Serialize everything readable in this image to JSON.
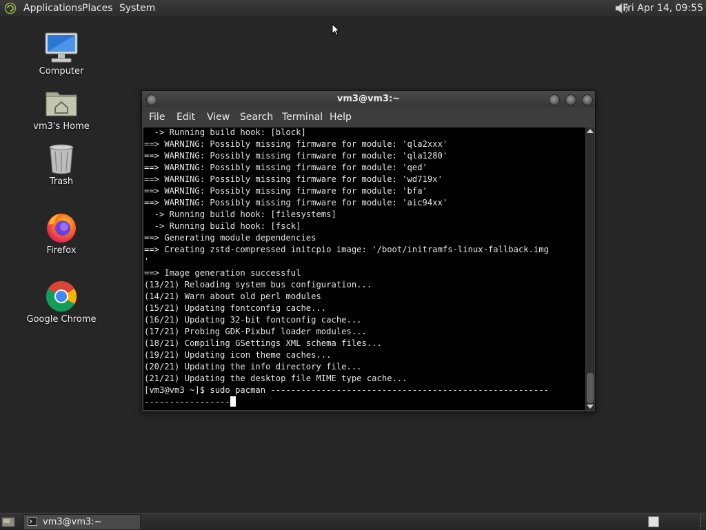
{
  "top_panel": {
    "menus": [
      "Applications",
      "Places",
      "System"
    ],
    "clock": "Fri Apr 14, 09:55"
  },
  "desktop_icons": [
    {
      "label": "Computer",
      "icon": "computer-icon"
    },
    {
      "label": "vm3's Home",
      "icon": "home-folder-icon"
    },
    {
      "label": "Trash",
      "icon": "trash-icon"
    },
    {
      "label": "Firefox",
      "icon": "firefox-icon"
    },
    {
      "label": "Google Chrome",
      "icon": "chrome-icon"
    }
  ],
  "terminal": {
    "title": "vm3@vm3:~",
    "menu": [
      "File",
      "Edit",
      "View",
      "Search",
      "Terminal",
      "Help"
    ],
    "lines": [
      "  -> Running build hook: [block]",
      "==> WARNING: Possibly missing firmware for module: 'qla2xxx'",
      "==> WARNING: Possibly missing firmware for module: 'qla1280'",
      "==> WARNING: Possibly missing firmware for module: 'qed'",
      "==> WARNING: Possibly missing firmware for module: 'wd719x'",
      "==> WARNING: Possibly missing firmware for module: 'bfa'",
      "==> WARNING: Possibly missing firmware for module: 'aic94xx'",
      "  -> Running build hook: [filesystems]",
      "  -> Running build hook: [fsck]",
      "==> Generating module dependencies",
      "==> Creating zstd-compressed initcpio image: '/boot/initramfs-linux-fallback.img",
      "'",
      "==> Image generation successful",
      "(13/21) Reloading system bus configuration...",
      "(14/21) Warn about old perl modules",
      "(15/21) Updating fontconfig cache...",
      "(16/21) Updating 32-bit fontconfig cache...",
      "(17/21) Probing GDK-Pixbuf loader modules...",
      "(18/21) Compiling GSettings XML schema files...",
      "(19/21) Updating icon theme caches...",
      "(20/21) Updating the info directory file...",
      "(21/21) Updating the desktop file MIME type cache...",
      "[vm3@vm3 ~]$ sudo pacman -------------------------------------------------------",
      "-----------------"
    ]
  },
  "taskbar": {
    "task_label": "vm3@vm3:~"
  },
  "colors": {
    "desktop_bg": "#262626",
    "terminal_bg": "#000000",
    "terminal_fg": "#e6e6e6"
  }
}
